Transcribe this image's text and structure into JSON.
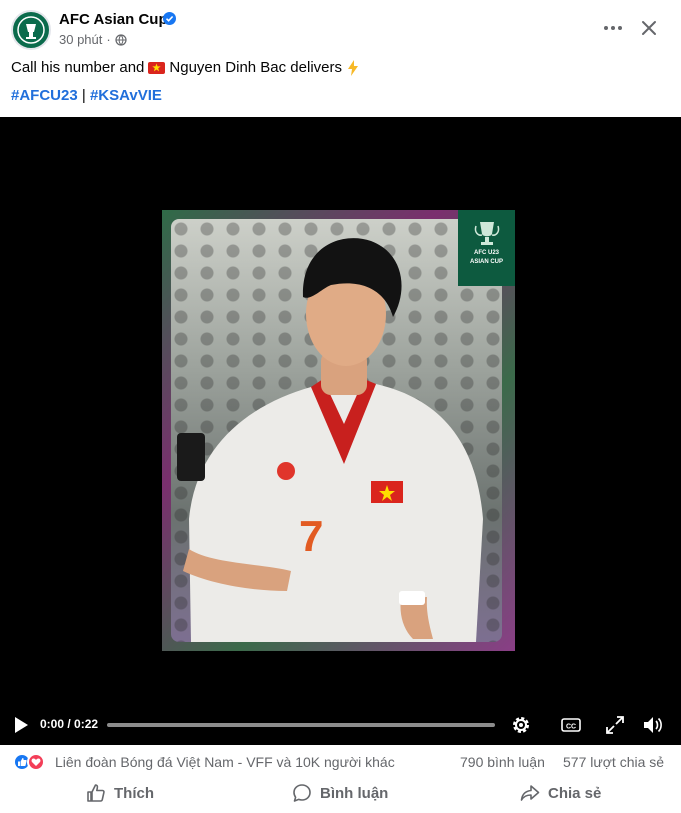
{
  "post": {
    "page_name": "AFC Asian Cup",
    "time": "30 phút",
    "separator": "·",
    "caption_before": "Call his number and",
    "caption_after": "Nguyen Dinh Bac delivers",
    "hashtags": [
      "#AFCU23",
      "#KSAvVIE"
    ],
    "hashtag_separator": "|"
  },
  "video": {
    "time_display": "0:00 / 0:22",
    "progress": 0,
    "badge_lines": [
      "AFC U23",
      "ASIAN CUP"
    ]
  },
  "stats": {
    "reactors": "Liên đoàn Bóng đá Việt Nam - VFF và 10K người khác",
    "comments": "790 bình luận",
    "shares": "577 lượt chia sẻ"
  },
  "actions": {
    "like": "Thích",
    "comment": "Bình luận",
    "share": "Chia sẻ"
  },
  "colors": {
    "hashtag": "#216fdb",
    "like_reaction": "#1877f2",
    "love_reaction": "#f33e58",
    "badge_green": "#0d5a3f"
  },
  "icons": [
    "avatar-logo",
    "verified-icon",
    "globe-icon",
    "more-icon",
    "close-icon",
    "vietnam-flag-icon",
    "lightning-icon",
    "play-icon",
    "settings-icon",
    "captions-icon",
    "fullscreen-icon",
    "volume-icon",
    "like-icon",
    "love-icon",
    "thumbs-up-icon",
    "comment-icon",
    "share-icon"
  ]
}
